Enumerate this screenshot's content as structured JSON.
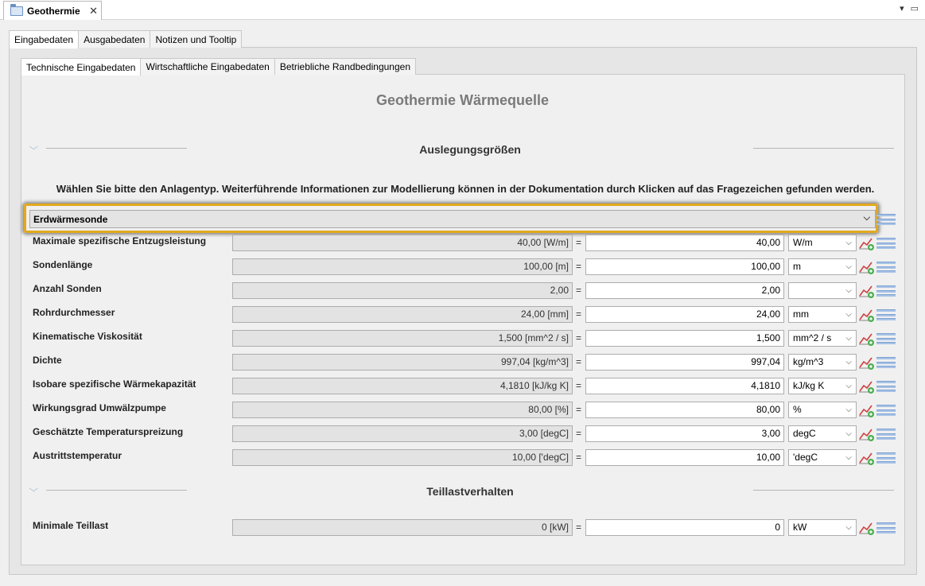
{
  "view": {
    "title": "Geothermie",
    "close_glyph": "✕",
    "menu_glyph": "▾",
    "minmax_glyph": "▭"
  },
  "outer_tabs": [
    {
      "label": "Eingabedaten",
      "active": true
    },
    {
      "label": "Ausgabedaten",
      "active": false
    },
    {
      "label": "Notizen und Tooltip",
      "active": false
    }
  ],
  "inner_tabs": [
    {
      "label": "Technische Eingabedaten",
      "active": true
    },
    {
      "label": "Wirtschaftliche Eingabedaten",
      "active": false
    },
    {
      "label": "Betriebliche Randbedingungen",
      "active": false
    }
  ],
  "page_title": "Geothermie Wärmequelle",
  "section1": {
    "title": "Auslegungsgrößen"
  },
  "instruction": "Wählen Sie bitte den Anlagentyp. Weiterführende Informationen zur Modellierung können in der Dokumentation durch Klicken auf das Fragezeichen gefunden werden.",
  "anlagentyp": {
    "selected": "Erdwärmesonde"
  },
  "rows": [
    {
      "label": "Maximale spezifische Entzugsleistung",
      "readonly": "40,00 [W/m]",
      "value": "40,00",
      "unit": "W/m"
    },
    {
      "label": "Sondenlänge",
      "readonly": "100,00 [m]",
      "value": "100,00",
      "unit": "m"
    },
    {
      "label": "Anzahl Sonden",
      "readonly": "2,00",
      "value": "2,00",
      "unit": ""
    },
    {
      "label": "Rohrdurchmesser",
      "readonly": "24,00 [mm]",
      "value": "24,00",
      "unit": "mm"
    },
    {
      "label": "Kinematische Viskosität",
      "readonly": "1,500 [mm^2 / s]",
      "value": "1,500",
      "unit": "mm^2 / s"
    },
    {
      "label": "Dichte",
      "readonly": "997,04 [kg/m^3]",
      "value": "997,04",
      "unit": "kg/m^3"
    },
    {
      "label": "Isobare spezifische Wärmekapazität",
      "readonly": "4,1810 [kJ/kg K]",
      "value": "4,1810",
      "unit": "kJ/kg K"
    },
    {
      "label": "Wirkungsgrad Umwälzpumpe",
      "readonly": "80,00 [%]",
      "value": "80,00",
      "unit": "%"
    },
    {
      "label": "Geschätzte Temperaturspreizung",
      "readonly": "3,00 [degC]",
      "value": "3,00",
      "unit": "degC"
    },
    {
      "label": "Austrittstemperatur",
      "readonly": "10,00 ['degC]",
      "value": "10,00",
      "unit": "'degC"
    }
  ],
  "section2": {
    "title": "Teillastverhalten"
  },
  "teillast_row": {
    "label": "Minimale Teillast",
    "readonly": "0 [kW]",
    "value": "0",
    "unit": "kW"
  },
  "equals_sign": "=",
  "chevron_glyph": "⌵",
  "colors": {
    "highlight": "#e2a91d",
    "title_gray": "#7a7a7a",
    "menu_blue": "#a7c2e6",
    "chart_red": "#d04040",
    "chart_green": "#4caf50"
  }
}
